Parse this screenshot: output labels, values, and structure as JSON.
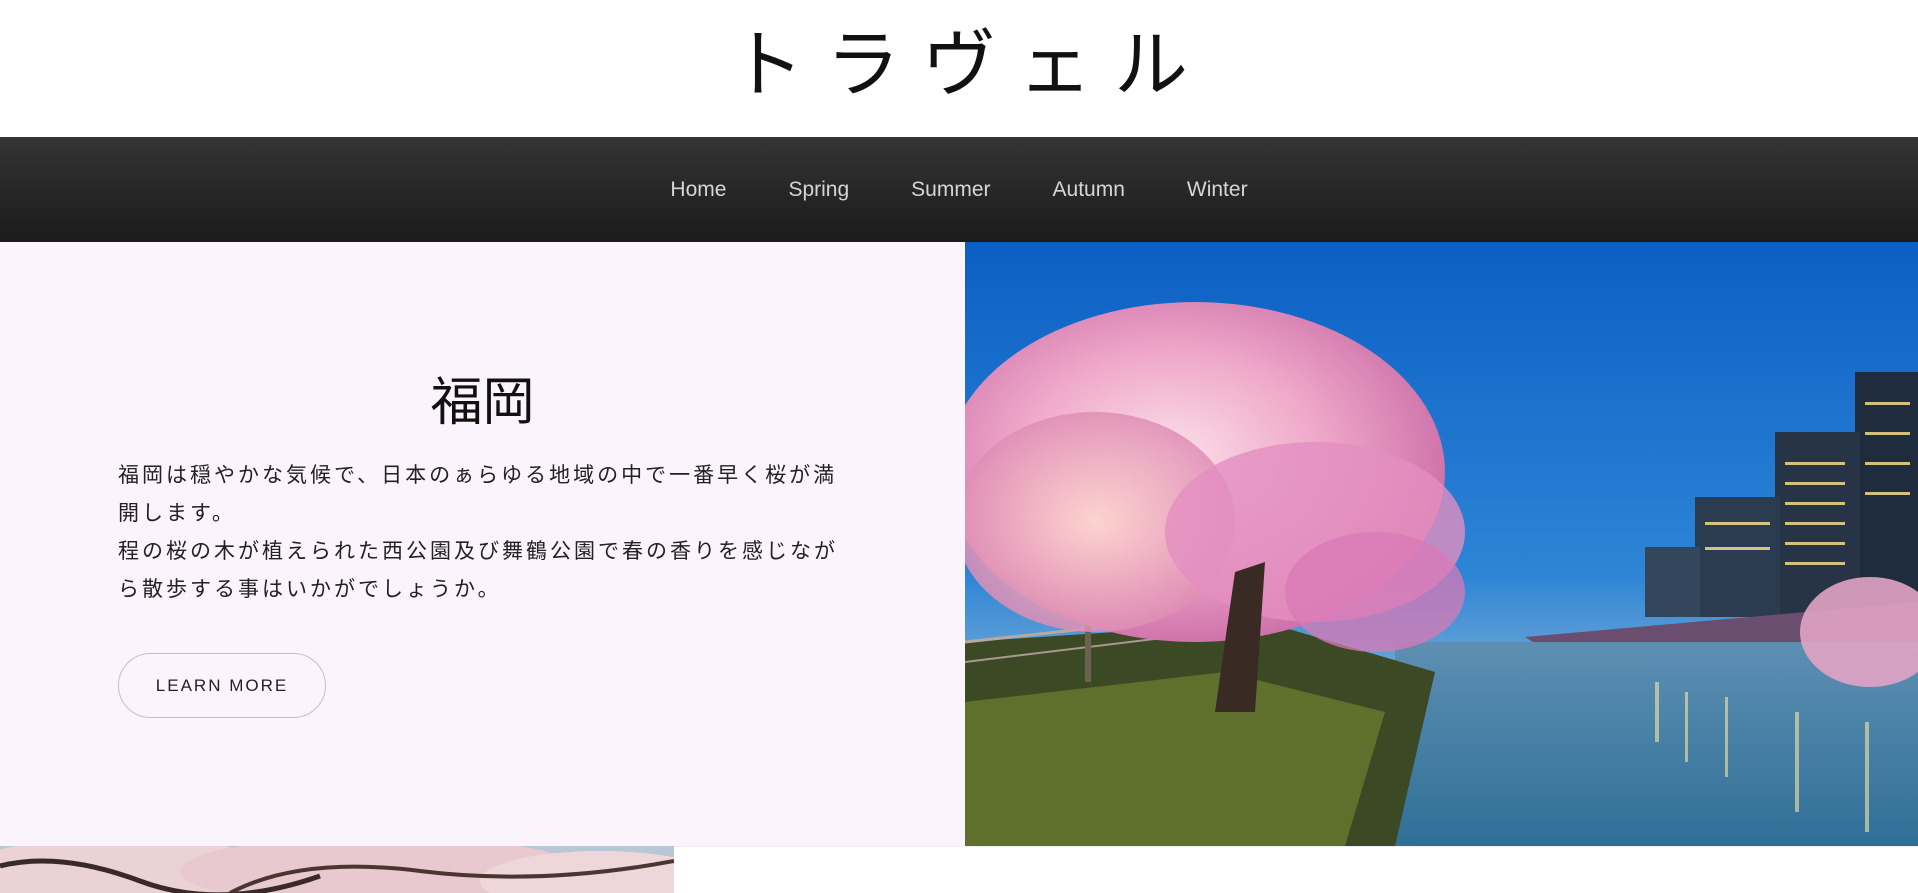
{
  "site": {
    "title": "トラヴェル"
  },
  "nav": {
    "items": [
      {
        "label": "Home"
      },
      {
        "label": "Spring"
      },
      {
        "label": "Summer"
      },
      {
        "label": "Autumn"
      },
      {
        "label": "Winter"
      }
    ]
  },
  "hero": {
    "heading": "福岡",
    "body_line1": "福岡は穏やかな気候で、日本のぁらゆる地域の中で一番早く桜が満開します。",
    "body_line2": "程の桜の木が植えられた西公園及び舞鶴公園で春の香りを感じながら散歩する事はいかがでしょうか。",
    "button_label": "LEARN MORE",
    "image": "cherry-blossom-river-night-photo"
  },
  "next_section": {
    "image": "cherry-blossom-branches-photo"
  },
  "colors": {
    "nav_background": "#262626",
    "nav_text": "#d6d6d6",
    "hero_panel_background": "#fcf4fc",
    "button_border": "#c7bfc7"
  }
}
